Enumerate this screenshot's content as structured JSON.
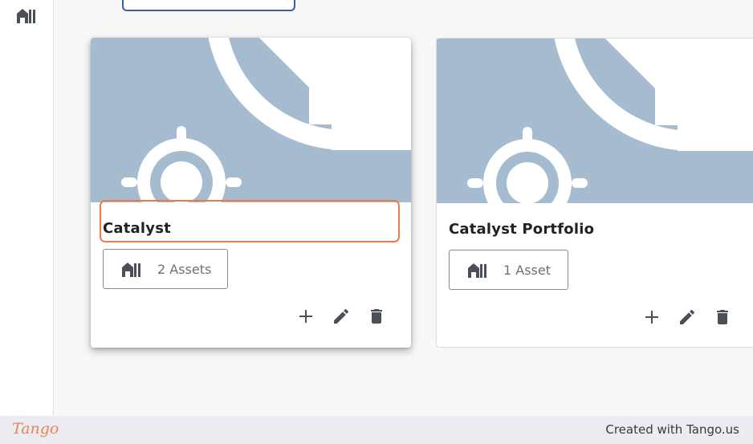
{
  "cards": [
    {
      "title": "Catalyst",
      "assets_label": "2 Assets",
      "selected": true
    },
    {
      "title": "Catalyst Portfolio",
      "assets_label": "1 Asset",
      "selected": false
    }
  ],
  "icons": {
    "sidebar": "assets-building-icon",
    "asset_button": "assets-building-icon",
    "add": "plus-icon",
    "edit": "pencil-icon",
    "delete": "trash-icon"
  },
  "colors": {
    "banner": "#a5bbcf",
    "highlight": "#ec7a45",
    "icon": "#4a4f5a",
    "brand": "#e8835a"
  },
  "footer": {
    "logo": "Tango",
    "credit": "Created with Tango.us"
  }
}
